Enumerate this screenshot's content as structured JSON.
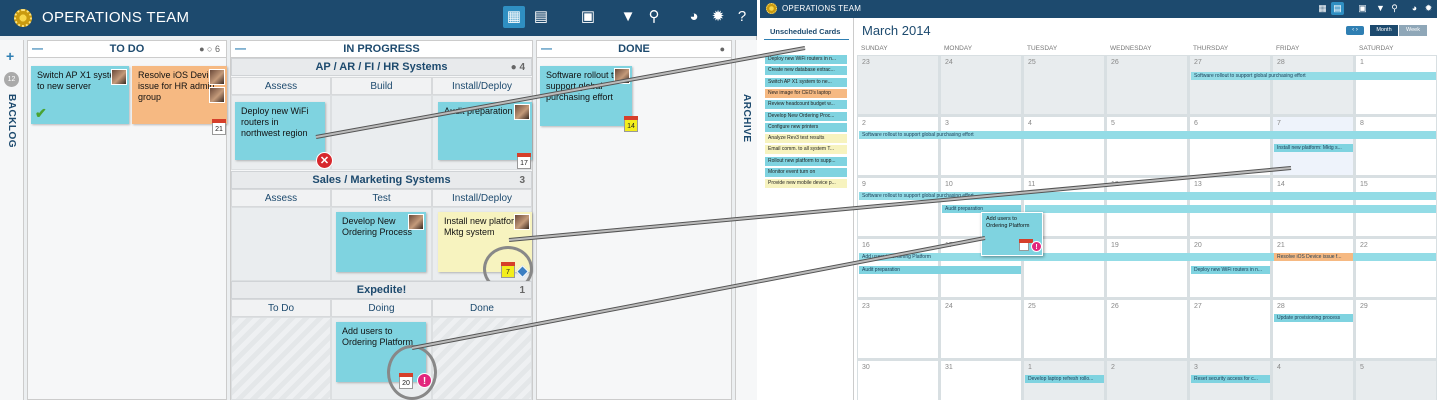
{
  "board": {
    "title": "OPERATIONS TEAM",
    "backlog_label": "BACKLOG",
    "backlog_count": "12",
    "archive_label": "ARCHIVE",
    "columns": {
      "todo": {
        "label": "TO DO",
        "count": "6"
      },
      "inprogress": {
        "label": "IN PROGRESS"
      },
      "done": {
        "label": "DONE"
      }
    },
    "groups": {
      "ap": {
        "label": "AP / AR / FI / HR Systems",
        "count": "4",
        "subs": [
          "Assess",
          "Build",
          "Install/Deploy"
        ]
      },
      "sales": {
        "label": "Sales / Marketing Systems",
        "count": "3",
        "subs": [
          "Assess",
          "Test",
          "Install/Deploy"
        ]
      },
      "expedite": {
        "label": "Expedite!",
        "count": "1",
        "subs": [
          "To Do",
          "Doing",
          "Done"
        ]
      }
    },
    "cards": {
      "switch_ap": "Switch AP X1 system to new server",
      "resolve_ios": "Resolve iOS Device issue for HR admin group",
      "resolve_ios_date": "21",
      "software_rollout": "Software rollout to support global purchasing effort",
      "software_rollout_date": "14",
      "deploy_wifi": "Deploy new WiFi routers in northwest region",
      "audit_prep": "Audit preparation",
      "audit_prep_date": "17",
      "develop_ordering": "Develop New Ordering Process",
      "install_platform": "Install new platform: Mktg system",
      "install_platform_date": "7",
      "add_users": "Add users to Ordering Platform",
      "add_users_date": "20"
    }
  },
  "calendar": {
    "app_title": "OPERATIONS TEAM",
    "unscheduled_title": "Unscheduled Cards",
    "unscheduled": [
      {
        "text": "Deploy new WiFi routers in n...",
        "color": "#7fd3e0"
      },
      {
        "text": "Create new database extrac...",
        "color": "#7fd3e0"
      },
      {
        "text": "Switch AP X1 system to ne...",
        "color": "#7fd3e0"
      },
      {
        "text": "New image for CEO's laptop",
        "color": "#f6b982"
      },
      {
        "text": "Review headcount budget w...",
        "color": "#7fd3e0"
      },
      {
        "text": "Develop New Ordering Proc...",
        "color": "#7fd3e0"
      },
      {
        "text": "Configure new printers",
        "color": "#7fd3e0"
      },
      {
        "text": "Analyze Rev3 test results",
        "color": "#f7f3bf"
      },
      {
        "text": "Email comm. to all system T...",
        "color": "#f7f3bf"
      },
      {
        "text": "Rollout new platform to supp...",
        "color": "#7fd3e0"
      },
      {
        "text": "Monitor event turn on",
        "color": "#7fd3e0"
      },
      {
        "text": "Provide new mobile device p...",
        "color": "#f7f3bf"
      }
    ],
    "month": "March 2014",
    "view_month": "Month",
    "view_week": "Week",
    "weekdays": [
      "SUNDAY",
      "MONDAY",
      "TUESDAY",
      "WEDNESDAY",
      "THURSDAY",
      "FRIDAY",
      "SATURDAY"
    ],
    "weeks": [
      [
        "23",
        "24",
        "25",
        "26",
        "27",
        "28",
        "1"
      ],
      [
        "2",
        "3",
        "4",
        "5",
        "6",
        "7",
        "8"
      ],
      [
        "9",
        "10",
        "11",
        "12",
        "13",
        "14",
        "15"
      ],
      [
        "16",
        "17",
        "18",
        "19",
        "20",
        "21",
        "22"
      ],
      [
        "23",
        "24",
        "25",
        "26",
        "27",
        "28",
        "29"
      ],
      [
        "30",
        "31",
        "1",
        "2",
        "3",
        "4",
        "5"
      ]
    ],
    "events": {
      "software_rollout": "Software rollout to support global purchasing effort",
      "install_platform": "Install new platform: Mktg s...",
      "audit_prep": "Audit preparation",
      "add_users_bar": "Add users to Ordering Platform",
      "deploy_wifi": "Deploy new WiFi routers in n...",
      "resolve_ios": "Resolve iOS Device issue f...",
      "update_prov": "Update provisioning process",
      "develop_laptop": "Develop laptop refresh rollo...",
      "reset_security": "Reset security access for c..."
    },
    "drag_card": "Add users to Ordering Platform"
  },
  "colors": {
    "topbar": "#1d4a6e",
    "card_blue": "#7fd3e0",
    "card_orange": "#f6b982",
    "card_yellow": "#f7f3bf",
    "accent": "#2f8fc2"
  },
  "icons": [
    "logo-icon",
    "board-view-icon",
    "calendar-icon",
    "add-card-icon",
    "filter-icon",
    "search-icon",
    "globe-icon",
    "gear-icon",
    "help-icon"
  ]
}
